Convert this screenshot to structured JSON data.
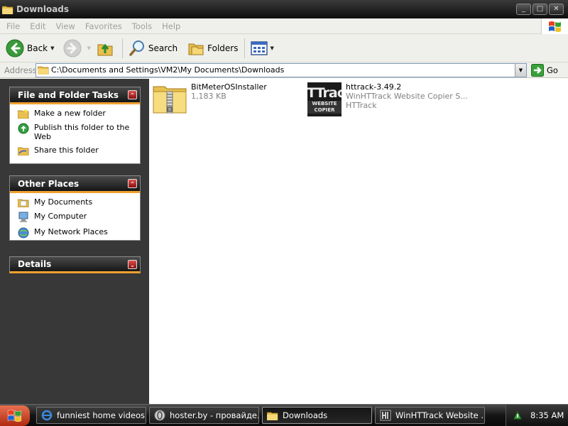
{
  "window": {
    "title": "Downloads",
    "buttons": {
      "minimize": "_",
      "maximize": "□",
      "close": "✕"
    }
  },
  "menu": [
    "File",
    "Edit",
    "View",
    "Favorites",
    "Tools",
    "Help"
  ],
  "toolbar": {
    "back_label": "Back",
    "search_label": "Search",
    "folders_label": "Folders"
  },
  "address": {
    "label": "Address",
    "path": "C:\\Documents and Settings\\VM2\\My Documents\\Downloads",
    "go_label": "Go"
  },
  "task_pane": {
    "file_tasks": {
      "title": "File and Folder Tasks",
      "items": [
        "Make a new folder",
        "Publish this folder to the Web",
        "Share this folder"
      ]
    },
    "other_places": {
      "title": "Other Places",
      "items": [
        "My Documents",
        "My Computer",
        "My Network Places"
      ]
    },
    "details": {
      "title": "Details"
    }
  },
  "files": [
    {
      "name": "BitMeterOSInstaller",
      "detail": "1,183 KB",
      "icon": "zip-folder-icon"
    },
    {
      "name": "httrack-3.49.2",
      "detail": "WinHTTrack Website Copier S...",
      "detail2": "HTTrack",
      "icon": "httrack-icon",
      "icon_text_big": "HTTrack",
      "icon_text_small": "WEBSITE COPIER"
    }
  ],
  "taskbar": {
    "buttons": [
      {
        "label": "funniest home videos ..."
      },
      {
        "label": "hoster.by - провайде..."
      },
      {
        "label": "Downloads"
      },
      {
        "label": "WinHTTrack Website ..."
      }
    ],
    "clock": "8:35 AM"
  },
  "colors": {
    "panel_accent": "#f0a030",
    "pane_bg": "#383838",
    "titlebar": "#1a1a1a"
  }
}
